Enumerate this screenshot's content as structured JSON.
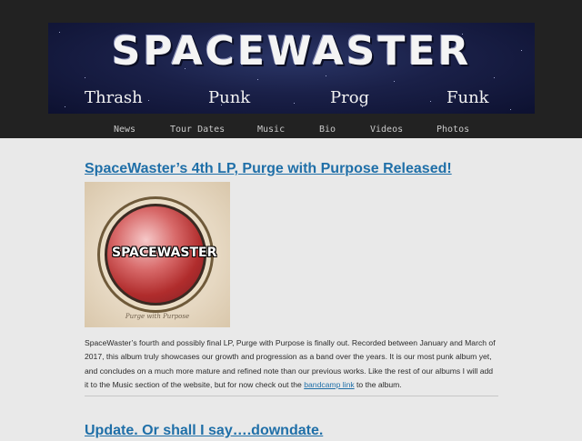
{
  "header": {
    "logo": "SPACEWASTER",
    "genres": [
      "Thrash",
      "Punk",
      "Prog",
      "Funk"
    ]
  },
  "nav": {
    "items": [
      "News",
      "Tour Dates",
      "Music",
      "Bio",
      "Videos",
      "Photos"
    ]
  },
  "posts": [
    {
      "title": "SpaceWaster’s 4th LP, Purge with Purpose Released!",
      "album_art": {
        "band_logo": "SPACEWASTER",
        "caption": "Purge with Purpose"
      },
      "body_before_link": "SpaceWaster’s fourth and possibly final LP, Purge with Purpose is finally out.  Recorded between January and March of 2017, this album truly showcases our growth and progression as a band over the years.  It is our most punk album yet, and concludes on a much more mature and refined note than our previous works.  Like the rest of our albums I will add it to the Music section of the website, but for now check out the ",
      "link_text": "bandcamp link",
      "body_after_link": " to the album."
    },
    {
      "title": "Update. Or shall I say….downdate."
    }
  ],
  "colors": {
    "page_background": "#e9e9e9",
    "header_background": "#222222",
    "link": "#1f6fa8"
  }
}
